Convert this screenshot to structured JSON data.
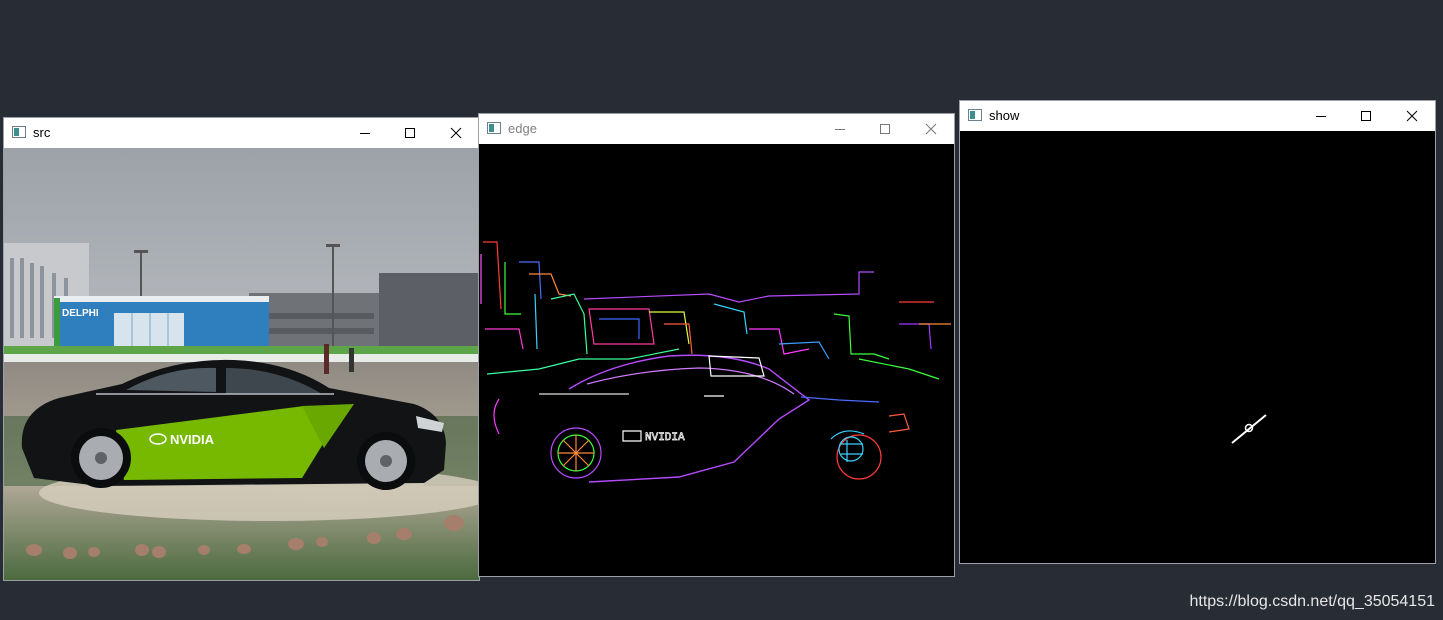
{
  "windows": [
    {
      "title": "src"
    },
    {
      "title": "edge"
    },
    {
      "title": "show"
    }
  ],
  "controls": {
    "minimize_icon": "minimize-icon",
    "maximize_icon": "maximize-icon",
    "close_icon": "close-icon"
  },
  "src_image": {
    "car_logo_text": "NVIDIA",
    "building_sign_text": "DELPHI"
  },
  "edge_image": {
    "car_logo_text": "NVIDIA"
  },
  "watermark": "https://blog.csdn.net/qq_35054151",
  "colors": {
    "desktop": "#282c34",
    "titlebar": "#ffffff",
    "canvas": "#000000",
    "nvidia_green": "#76b900"
  }
}
